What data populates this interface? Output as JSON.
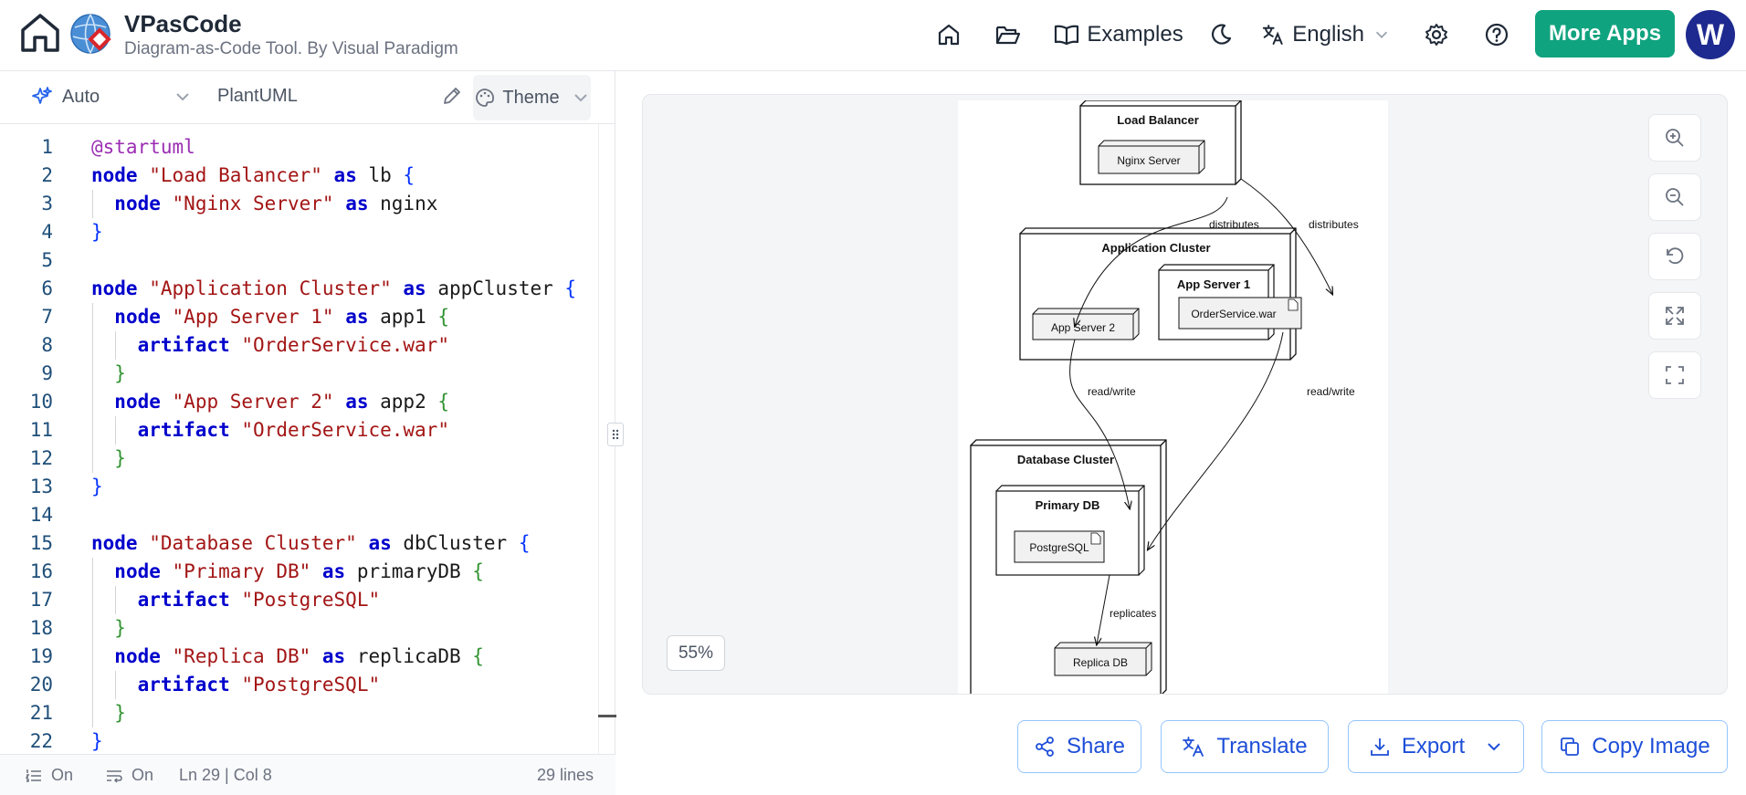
{
  "header": {
    "brand_title": "VPasCode",
    "brand_subtitle": "Diagram-as-Code Tool. By Visual Paradigm",
    "nav": {
      "examples": "Examples",
      "language": "English",
      "more_apps": "More Apps",
      "avatar_initial": "W"
    },
    "icons": [
      "home-icon",
      "folder-open-icon",
      "book-icon",
      "moon-icon",
      "translate-icon",
      "gear-icon",
      "help-icon"
    ]
  },
  "editor": {
    "toolbar": {
      "mode": "Auto",
      "language": "PlantUML",
      "theme": "Theme"
    },
    "code_lines": [
      "@startuml",
      "node \"Load Balancer\" as lb {",
      "  node \"Nginx Server\" as nginx",
      "}",
      "",
      "node \"Application Cluster\" as appCluster {",
      "  node \"App Server 1\" as app1 {",
      "    artifact \"OrderService.war\"",
      "  }",
      "  node \"App Server 2\" as app2 {",
      "    artifact \"OrderService.war\"",
      "  }",
      "}",
      "",
      "node \"Database Cluster\" as dbCluster {",
      "  node \"Primary DB\" as primaryDB {",
      "    artifact \"PostgreSQL\"",
      "  }",
      "  node \"Replica DB\" as replicaDB {",
      "    artifact \"PostgreSQL\"",
      "  }",
      "}"
    ],
    "line_numbers": [
      "1",
      "2",
      "3",
      "4",
      "5",
      "6",
      "7",
      "8",
      "9",
      "10",
      "11",
      "12",
      "13",
      "14",
      "15",
      "16",
      "17",
      "18",
      "19",
      "20",
      "21",
      "22"
    ],
    "status": {
      "line_numbers_toggle": "On",
      "wrap_toggle": "On",
      "cursor": "Ln 29 | Col 8",
      "total_lines": "29 lines"
    }
  },
  "preview": {
    "zoom_level": "55%",
    "diagram": {
      "load_balancer": "Load Balancer",
      "nginx": "Nginx Server",
      "app_cluster": "Application Cluster",
      "app_server_1": "App Server 1",
      "app_server_2": "App Server 2",
      "order_service": "OrderService.war",
      "db_cluster": "Database Cluster",
      "primary_db": "Primary DB",
      "postgresql": "PostgreSQL",
      "replica_db": "Replica DB",
      "edge_distributes": "distributes",
      "edge_read_write": "read/write",
      "edge_replicates": "replicates"
    }
  },
  "actions": {
    "share": "Share",
    "translate": "Translate",
    "export": "Export",
    "copy_image": "Copy Image"
  }
}
